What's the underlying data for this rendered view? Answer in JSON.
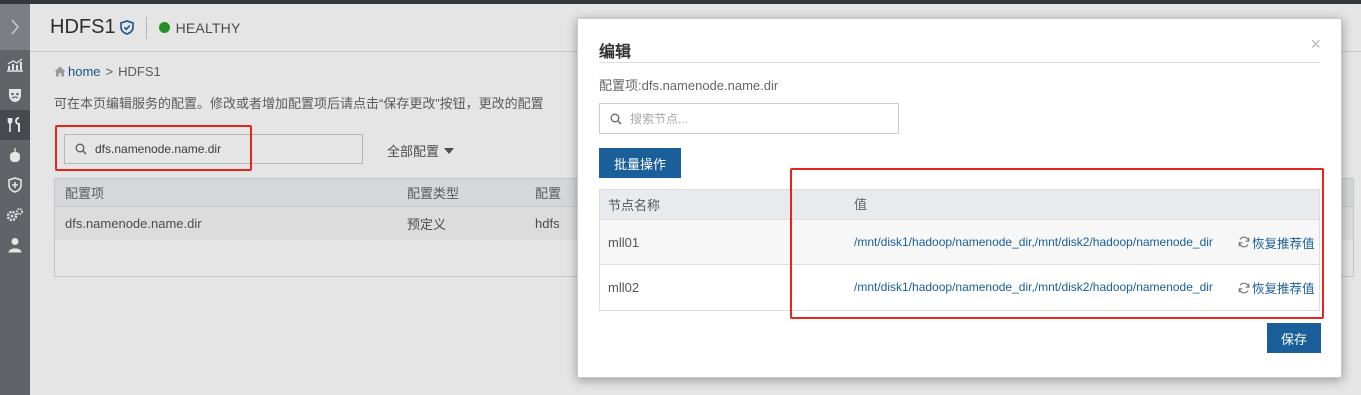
{
  "page": {
    "title": "HDFS1",
    "status": "HEALTHY",
    "status_color": "#2ca02c",
    "breadcrumb": {
      "home": "home",
      "separator": ">",
      "current": "HDFS1"
    },
    "description": "可在本页编辑服务的配置。修改或者增加配置项后请点击“保存更改”按钮，更改的配置",
    "search_value": "dfs.namenode.name.dir",
    "scope_dropdown": "全部配置",
    "table": {
      "headers": [
        "配置项",
        "配置类型",
        "配置"
      ],
      "rows": [
        [
          "dfs.namenode.name.dir",
          "预定义",
          "hdfs"
        ]
      ]
    }
  },
  "sidebar": {
    "icons": [
      "chevron-right-icon",
      "dashboard-chart-icon",
      "mask-icon",
      "tools-icon",
      "mouse-icon",
      "shield-plus-icon",
      "gears-icon",
      "user-icon"
    ],
    "active": "tools-icon"
  },
  "modal": {
    "title": "编辑",
    "close": "×",
    "config_label": "配置项:dfs.namenode.name.dir",
    "node_search_placeholder": "搜索节点...",
    "batch_button": "批量操作",
    "headers": {
      "node": "节点名称",
      "value": "值"
    },
    "rows": [
      {
        "node": "mll01",
        "value": "/mnt/disk1/hadoop/namenode_dir,/mnt/disk2/hadoop/namenode_dir",
        "action": "恢复推荐值"
      },
      {
        "node": "mll02",
        "value": "/mnt/disk1/hadoop/namenode_dir,/mnt/disk2/hadoop/namenode_dir",
        "action": "恢复推荐值"
      }
    ],
    "save_button": "保存"
  },
  "colors": {
    "accent": "#1a5f99",
    "highlight": "#e8231c",
    "sidebar": "#6b6f73"
  }
}
